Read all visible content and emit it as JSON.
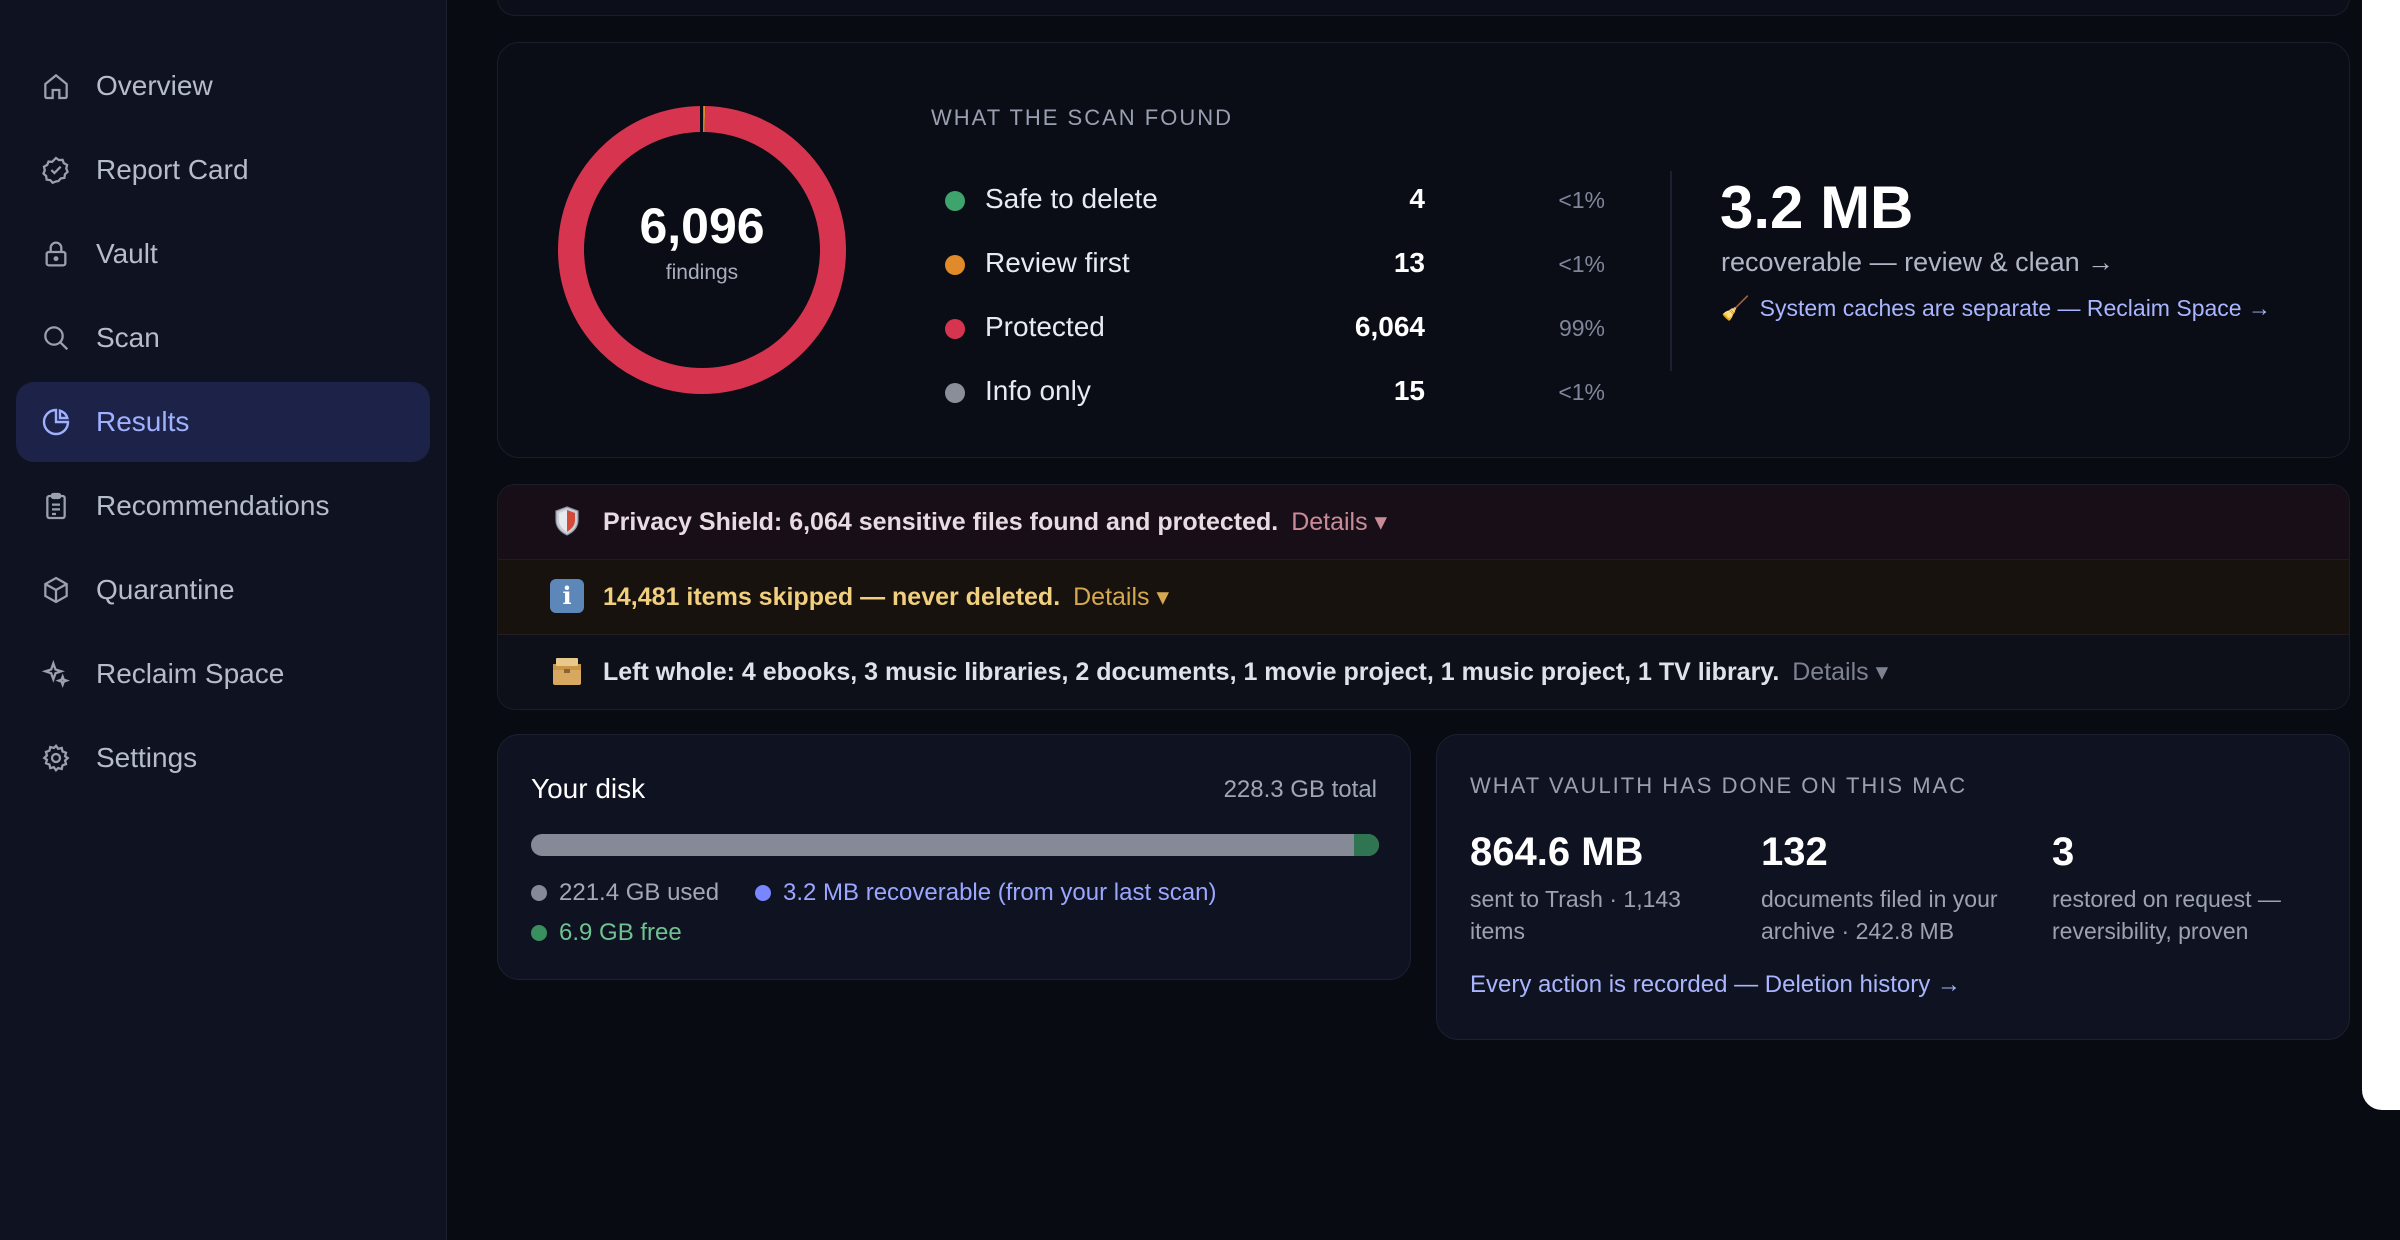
{
  "sidebar": {
    "items": [
      {
        "label": "Overview",
        "icon": "home-icon"
      },
      {
        "label": "Report Card",
        "icon": "check-badge-icon"
      },
      {
        "label": "Vault",
        "icon": "lock-icon"
      },
      {
        "label": "Scan",
        "icon": "search-icon"
      },
      {
        "label": "Results",
        "icon": "pie-chart-icon",
        "active": true
      },
      {
        "label": "Recommendations",
        "icon": "clipboard-icon"
      },
      {
        "label": "Quarantine",
        "icon": "box-icon"
      },
      {
        "label": "Reclaim Space",
        "icon": "sparkles-icon"
      },
      {
        "label": "Settings",
        "icon": "gear-icon"
      }
    ]
  },
  "scan": {
    "total": "6,096",
    "total_label": "findings",
    "title": "WHAT THE SCAN FOUND",
    "rows": [
      {
        "label": "Safe to delete",
        "count": "4",
        "pct": "<1%",
        "color": "#3ea36d"
      },
      {
        "label": "Review first",
        "count": "13",
        "pct": "<1%",
        "color": "#e08a2a"
      },
      {
        "label": "Protected",
        "count": "6,064",
        "pct": "99%",
        "color": "#d7344f"
      },
      {
        "label": "Info only",
        "count": "15",
        "pct": "<1%",
        "color": "#8a8e99"
      }
    ],
    "donut_share": {
      "safe": 4,
      "review": 13,
      "protected": 6064,
      "info": 15
    },
    "recoverable_size": "3.2 MB",
    "recoverable_link": "recoverable — review & clean →",
    "cache_emoji": "🧹",
    "cache_link": "System caches are separate — Reclaim Space →"
  },
  "banners": {
    "privacy": {
      "text": "Privacy Shield: 6,064 sensitive files found and protected.",
      "details": "Details ▾",
      "icon": "shield-icon"
    },
    "skipped": {
      "text": "14,481 items skipped — never deleted.",
      "details": "Details ▾",
      "icon": "info-icon"
    },
    "whole": {
      "text": "Left whole: 4 ebooks, 3 music libraries, 2 documents, 1 movie project, 1 music project, 1 TV library.",
      "details": "Details ▾",
      "icon": "package-icon"
    }
  },
  "disk": {
    "title": "Your disk",
    "total": "228.3 GB total",
    "used": "221.4 GB used",
    "recoverable": "3.2 MB recoverable (from your last scan)",
    "free": "6.9 GB free",
    "used_fraction": 0.97,
    "colors": {
      "used": "#858a96",
      "recoverable": "#7a86ff",
      "free": "#3a8f5f"
    }
  },
  "vaulith": {
    "title": "WHAT VAULITH HAS DONE ON THIS MAC",
    "stats": [
      {
        "value": "864.6 MB",
        "desc": "sent to Trash · 1,143 items"
      },
      {
        "value": "132",
        "desc": "documents filed in your archive · 242.8 MB"
      },
      {
        "value": "3",
        "desc": "restored on request — reversibility, proven"
      }
    ],
    "link": "Every action is recorded — Deletion history →"
  }
}
